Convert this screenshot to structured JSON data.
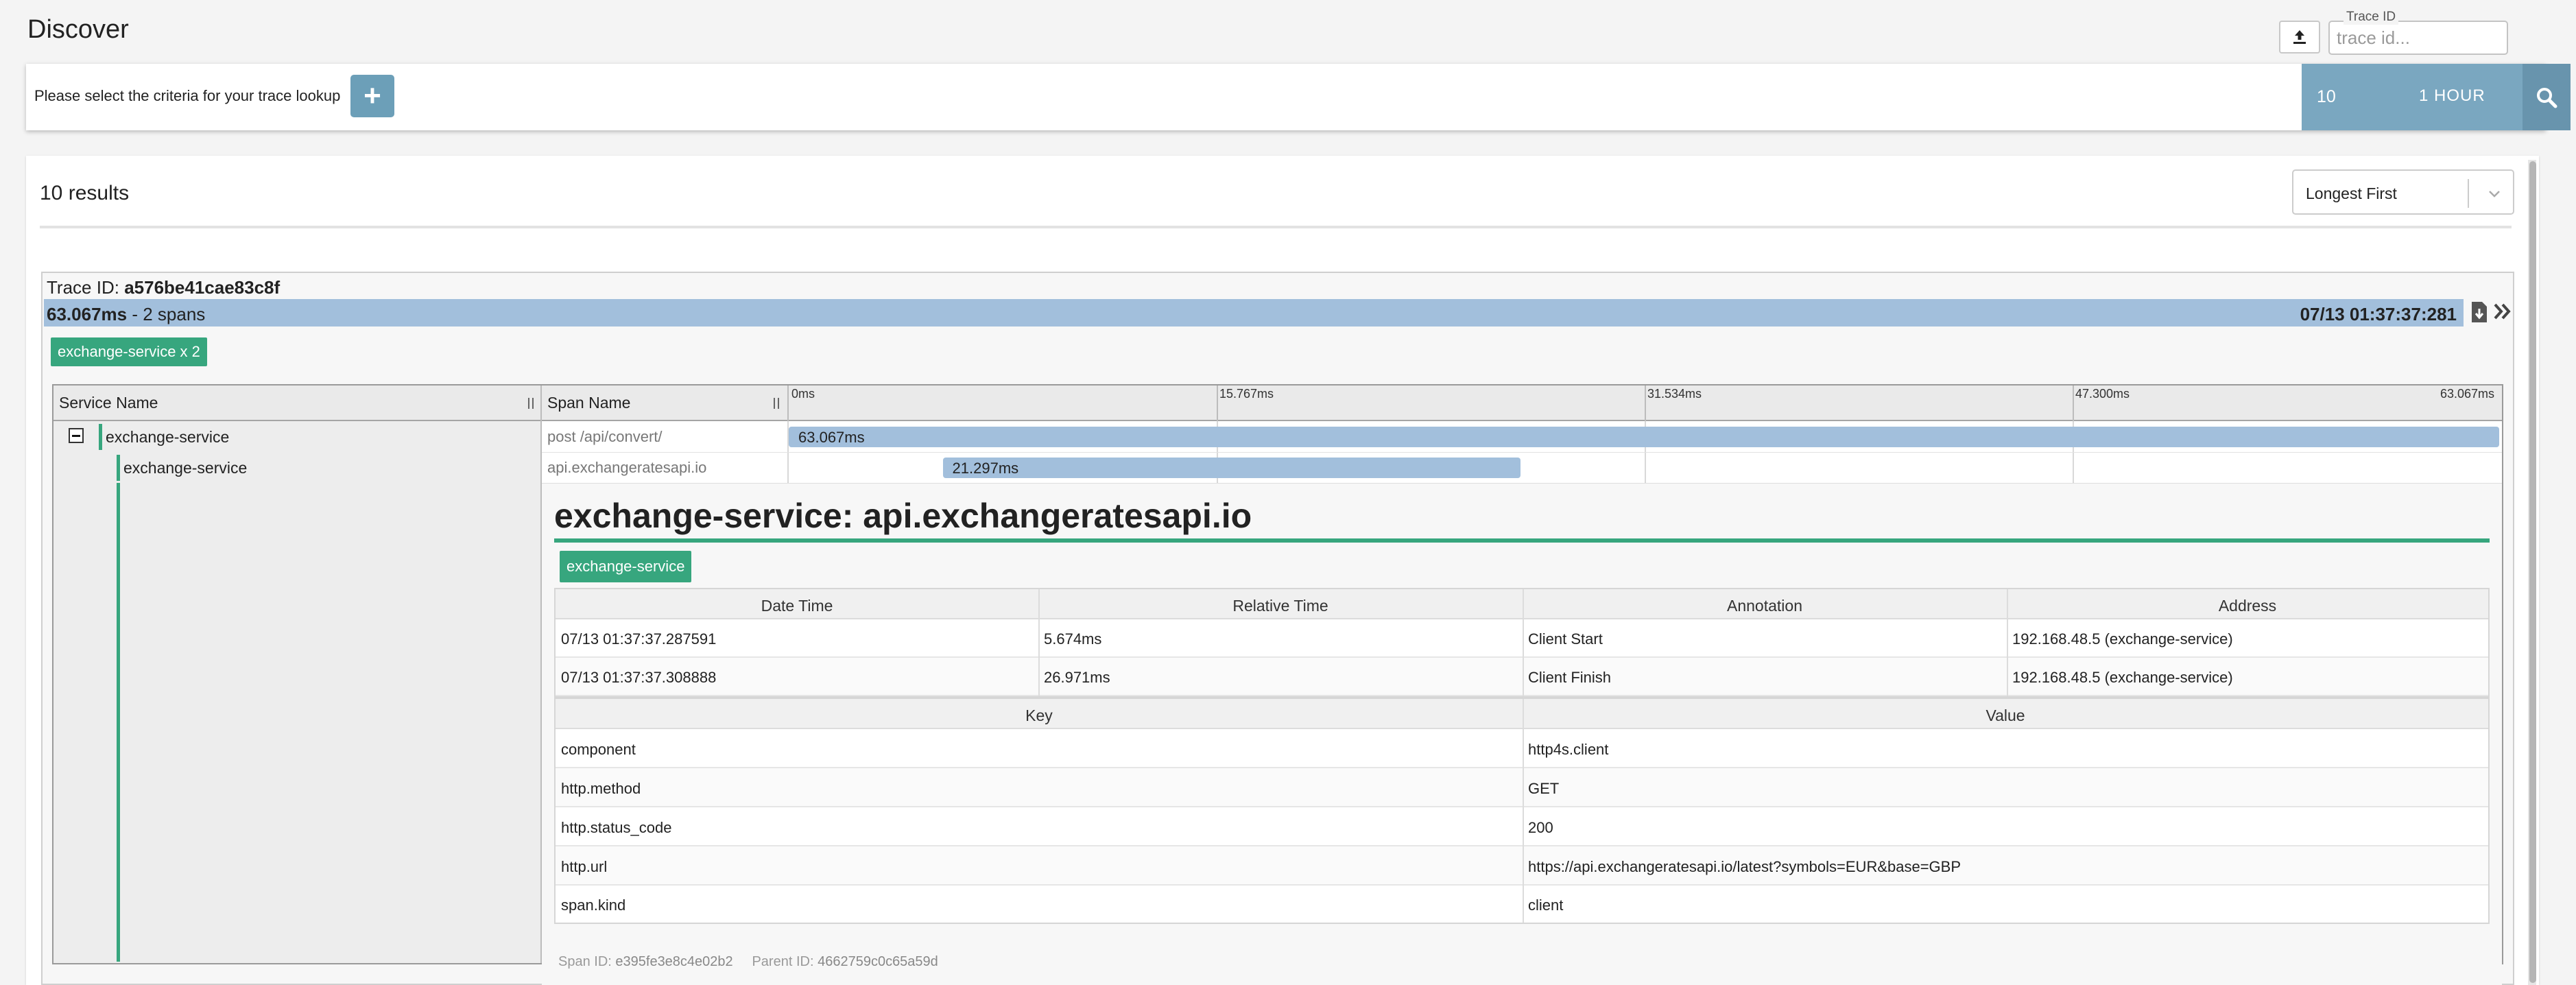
{
  "page": {
    "title": "Discover"
  },
  "trace_lookup": {
    "label": "Trace ID",
    "placeholder": "trace id..."
  },
  "criteria": {
    "prompt": "Please select the criteria for your trace lookup",
    "add_label": "+"
  },
  "query": {
    "limit": "10",
    "lookback": "1 HOUR"
  },
  "results": {
    "count_label": "10 results",
    "sort_value": "Longest First"
  },
  "trace": {
    "id_label": "Trace ID:",
    "id": "a576be41cae83c8f",
    "duration": "63.067ms",
    "span_count": "- 2 spans",
    "timestamp": "07/13 01:37:37:281",
    "service_badge": "exchange-service x 2",
    "columns": {
      "service": "Service Name",
      "span": "Span Name"
    },
    "ticks": [
      "0ms",
      "15.767ms",
      "31.534ms",
      "47.300ms",
      "63.067ms"
    ],
    "spans": [
      {
        "service": "exchange-service",
        "name": "post /api/convert/",
        "duration": "63.067ms",
        "start_ms": 0,
        "duration_ms": 63.067
      },
      {
        "service": "exchange-service",
        "name": "api.exchangeratesapi.io",
        "duration": "21.297ms",
        "start_ms": 5.674,
        "duration_ms": 21.297
      }
    ],
    "total_ms": 63.067
  },
  "span_detail": {
    "title": "exchange-service: api.exchangeratesapi.io",
    "badge": "exchange-service",
    "annotation_headers": [
      "Date Time",
      "Relative Time",
      "Annotation",
      "Address"
    ],
    "annotations": [
      [
        "07/13 01:37:37.287591",
        "5.674ms",
        "Client Start",
        "192.168.48.5 (exchange-service)"
      ],
      [
        "07/13 01:37:37.308888",
        "26.971ms",
        "Client Finish",
        "192.168.48.5 (exchange-service)"
      ]
    ],
    "tag_headers": [
      "Key",
      "Value"
    ],
    "tags": [
      [
        "component",
        "http4s.client"
      ],
      [
        "http.method",
        "GET"
      ],
      [
        "http.status_code",
        "200"
      ],
      [
        "http.url",
        "https://api.exchangeratesapi.io/latest?symbols=EUR&base=GBP"
      ],
      [
        "span.kind",
        "client"
      ]
    ],
    "span_id_label": "Span ID:",
    "span_id": "e395fe3e8c4e02b2",
    "parent_id_label": "Parent ID:",
    "parent_id": "4662759c0c65a59d"
  },
  "colors": {
    "accent_green": "#37a67e",
    "span_bar": "#a2bfdc",
    "query_blue": "#7aa7c0"
  },
  "icons": [
    "upload-icon",
    "plus-icon",
    "search-icon",
    "chevron-down-icon",
    "download-icon",
    "double-chevron-right-icon",
    "collapse-icon"
  ]
}
